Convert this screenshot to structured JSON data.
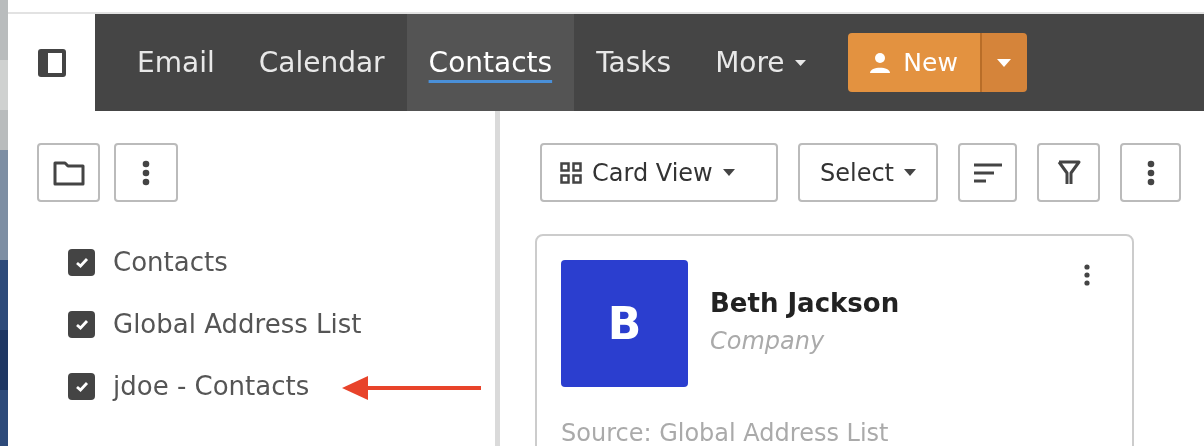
{
  "nav": {
    "tabs": [
      {
        "label": "Email",
        "selected": false,
        "dropdown": false
      },
      {
        "label": "Calendar",
        "selected": false,
        "dropdown": false
      },
      {
        "label": "Contacts",
        "selected": true,
        "dropdown": false
      },
      {
        "label": "Tasks",
        "selected": false,
        "dropdown": false
      },
      {
        "label": "More",
        "selected": false,
        "dropdown": true
      }
    ],
    "new_button": {
      "label": "New"
    }
  },
  "folders": [
    {
      "label": "Contacts",
      "checked": true
    },
    {
      "label": "Global Address List",
      "checked": true
    },
    {
      "label": "jdoe - Contacts",
      "checked": true
    }
  ],
  "toolbar": {
    "view": "Card View",
    "select": "Select"
  },
  "cards": [
    {
      "initial": "B",
      "name": "Beth Jackson",
      "company": "Company",
      "source": "Source: Global Address List",
      "color": "#2b3ecf"
    }
  ]
}
